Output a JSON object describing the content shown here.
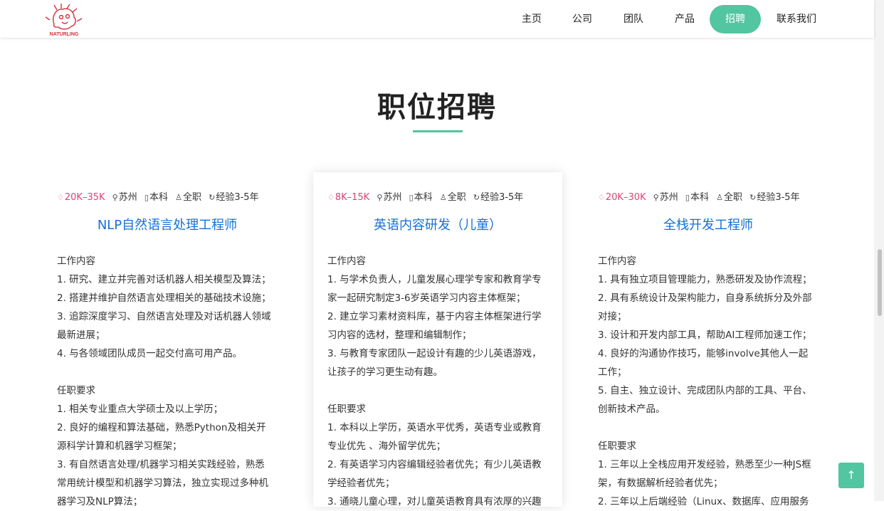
{
  "header": {
    "logo_text": "NATURLING",
    "nav": [
      {
        "label": "主页",
        "active": false
      },
      {
        "label": "公司",
        "active": false
      },
      {
        "label": "团队",
        "active": false
      },
      {
        "label": "产品",
        "active": false
      },
      {
        "label": "招聘",
        "active": true
      },
      {
        "label": "联系我们",
        "active": false
      }
    ]
  },
  "page": {
    "title": "职位招聘"
  },
  "colors": {
    "accent": "#52c5a1",
    "link": "#1670d6",
    "salary": "#e63e74"
  },
  "jobs": [
    {
      "salary": "20K–35K",
      "city": "苏州",
      "education": "本科",
      "type": "全职",
      "experience": "经验3-5年",
      "title": "NLP自然语言处理工程师",
      "lines": [
        "工作内容",
        "1. 研究、建立并完善对话机器人相关模型及算法；",
        "2. 搭建并维护自然语言处理相关的基础技术设施；",
        "3. 追踪深度学习、自然语言处理及对话机器人领域",
        "最新进展；",
        "4. 与各领域团队成员一起交付高可用产品。",
        "",
        "任职要求",
        "1. 相关专业重点大学硕士及以上学历；",
        "2. 良好的编程和算法基础，熟悉Python及相关开",
        "源科学计算和机器学习框架；",
        "3. 有自然语言处理/机器学习相关实践经验，熟悉",
        "常用统计模型和机器学习算法，独立实现过多种机",
        "器学习及NLP算法；"
      ]
    },
    {
      "salary": "8K–15K",
      "city": "苏州",
      "education": "本科",
      "type": "全职",
      "experience": "经验3-5年",
      "title": "英语内容研发（儿童）",
      "lines": [
        "工作内容",
        "1. 与学术负责人，儿童发展心理学专家和教育学专",
        "家一起研究制定3-6岁英语学习内容主体框架；",
        "2. 建立学习素材资料库，基于内容主体框架进行学",
        "习内容的选材，整理和编辑制作；",
        "3. 与教育专家团队一起设计有趣的少儿英语游戏，",
        "让孩子的学习更生动有趣。",
        "",
        "任职要求",
        "1. 本科以上学历，英语水平优秀，英语专业或教育",
        "专业优先 、海外留学优先；",
        "2. 有英语学习内容编辑经验者优先；有少儿英语教",
        "学经验者优先；",
        "3. 通晓儿童心理，对儿童英语教育具有浓厚的兴趣"
      ]
    },
    {
      "salary": "20K–30K",
      "city": "苏州",
      "education": "本科",
      "type": "全职",
      "experience": "经验3-5年",
      "title": "全栈开发工程师",
      "lines": [
        "工作内容",
        "1. 具有独立项目管理能力，熟悉研发及协作流程；",
        "2. 具有系统设计及架构能力，自身系统拆分及外部",
        "对接；",
        "3. 设计和开发内部工具，帮助AI工程师加速工作；",
        "4. 良好的沟通协作技巧，能够involve其他人一起",
        "工作；",
        "5. 自主、独立设计、完成团队内部的工具、平台、",
        "创新技术产品。",
        "",
        "任职要求",
        "1. 三年以上全栈应用开发经验，熟悉至少一种JS框",
        "架，有数据解析经验者优先；",
        "2. 三年以上后端经验（Linux、数据库、应用服务"
      ]
    }
  ],
  "back_to_top": {
    "icon": "arrow-up-icon",
    "glyph": "↑"
  }
}
